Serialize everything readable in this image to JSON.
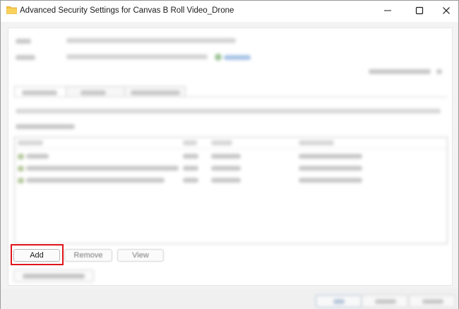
{
  "window": {
    "title": "Advanced Security Settings for Canvas B Roll Video_Drone",
    "minimize_glyph": "—",
    "maximize_glyph": "☐",
    "close_glyph": "✕"
  },
  "buttons": {
    "add_label": "Add",
    "remove_label": "Remove",
    "view_label": "View"
  },
  "colors": {
    "highlight": "#e0151b",
    "folder": "#f4c542"
  },
  "icons": {
    "title": "folder-icon"
  }
}
